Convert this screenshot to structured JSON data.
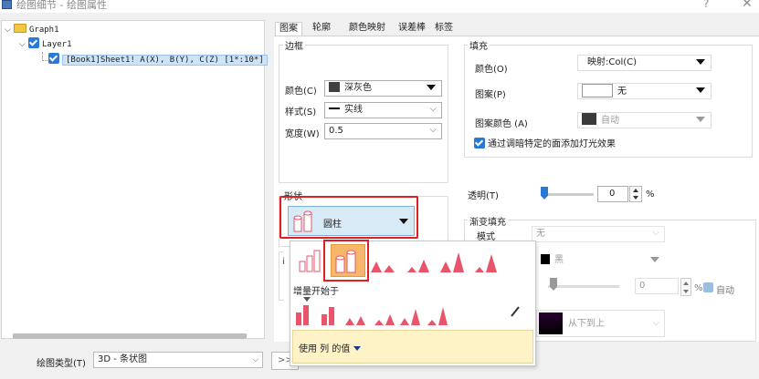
{
  "window": {
    "title": "绘图细节 - 绘图属性",
    "help": "?",
    "close": "✕"
  },
  "tree": {
    "graph": "Graph1",
    "layer": "Layer1",
    "plot": "[Book1]Sheet1! A(X), B(Y), C(Z) [1*:10*]"
  },
  "bottom": {
    "plot_type_label": "绘图类型(T)",
    "plot_type_value": "3D - 条状图",
    "expand": ">>"
  },
  "tabs": [
    "图案",
    "轮廓",
    "颜色映射",
    "误差棒",
    "标签"
  ],
  "border": {
    "group": "边框",
    "color_label": "颜色(C)",
    "color_value": "深灰色",
    "style_label": "样式(S)",
    "style_value": "实线",
    "width_label": "宽度(W)",
    "width_value": "0.5"
  },
  "fill": {
    "group": "填充",
    "color_label": "颜色(O)",
    "color_value": "映射:Col(C)",
    "pattern_label": "图案(P)",
    "pattern_value": "无",
    "pattern_color_label": "图案颜色 (A)",
    "pattern_color_value": "自动",
    "light_effect_label": "通过调暗特定的面添加灯光效果"
  },
  "shape": {
    "group": "形状",
    "value": "圆柱"
  },
  "transparency": {
    "label": "透明(T)",
    "value": "0",
    "unit": "%",
    "level": 0
  },
  "gradient": {
    "group": "渐变填充",
    "mode_label": "模式",
    "mode_value": "无",
    "color_value": "黑",
    "spin_value": "0",
    "unit": "%",
    "auto_label": "自动",
    "direction_value": "从下到上"
  },
  "popup": {
    "increment_label": "增量开始于",
    "footer": "使用 列 的值"
  },
  "colors": {
    "accent": "#2a7ad5",
    "highlight": "#e02020",
    "selected_cell": "#f6b76a",
    "shape_red": "#e8546a"
  }
}
